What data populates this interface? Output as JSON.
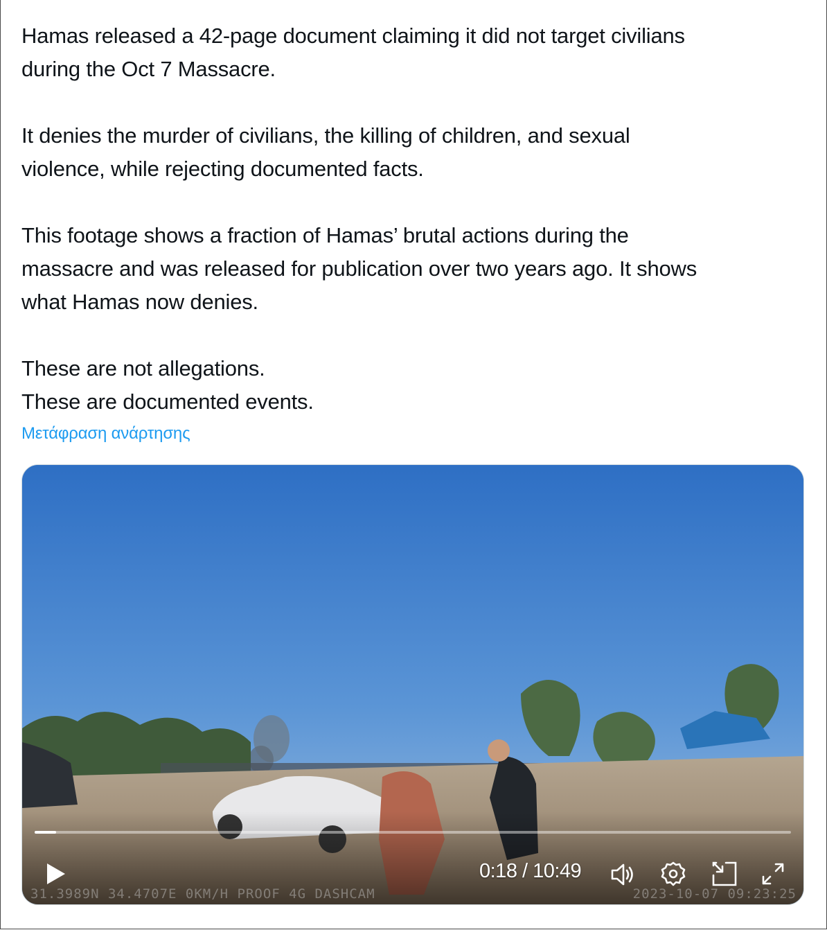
{
  "post": {
    "paragraphs": [
      "Hamas released a 42-page document claiming it did not target civilians\nduring the Oct 7 Massacre.",
      "It denies the murder of civilians, the killing of children, and sexual\nviolence, while rejecting documented facts.",
      "This footage shows a fraction of Hamas’ brutal actions during the\nmassacre and was released for publication over two years ago. It shows\nwhat Hamas now denies.",
      "These are not allegations.\nThese are documented events."
    ],
    "translate_label": "Μετάφραση ανάρτησης"
  },
  "video": {
    "time_label": "0:18 / 10:49",
    "progress_fraction": 0.028,
    "dashcam_overlay_left": "31.3989N  34.4707E  0KM/H  PROOF 4G DASHCAM",
    "dashcam_overlay_right": "2023-10-07 09:23:25",
    "icons": {
      "play": "play-icon",
      "volume": "volume-icon",
      "settings": "gear-icon",
      "miniplayer": "pip-icon",
      "fullscreen": "fullscreen-icon"
    }
  },
  "colors": {
    "text": "#0f1419",
    "link": "#1d9bf0",
    "sky": "#3a78c9"
  }
}
